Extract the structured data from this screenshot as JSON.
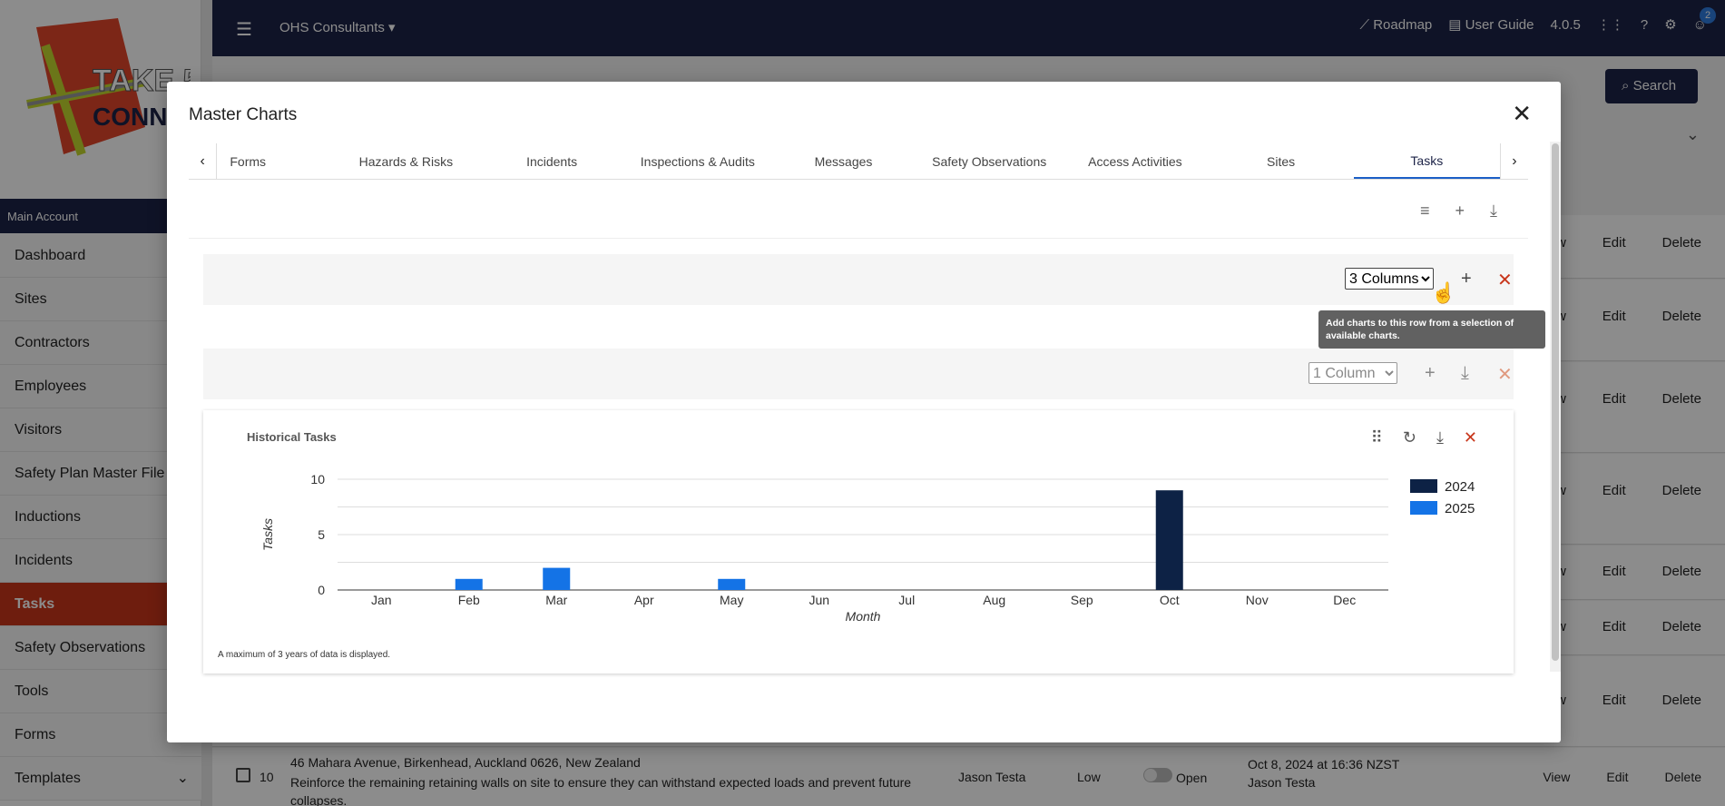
{
  "app": {
    "org_name": "OHS Consultants",
    "roadmap": "Roadmap",
    "user_guide": "User Guide",
    "version": "4.0.5",
    "notif_count": "2",
    "page_title": "Tasks",
    "search_label": "Search"
  },
  "sidebar": {
    "account": "Main Account",
    "items": [
      {
        "label": "Dashboard"
      },
      {
        "label": "Sites"
      },
      {
        "label": "Contractors"
      },
      {
        "label": "Employees"
      },
      {
        "label": "Visitors"
      },
      {
        "label": "Safety Plan Master File"
      },
      {
        "label": "Inductions"
      },
      {
        "label": "Incidents"
      },
      {
        "label": "Tasks"
      },
      {
        "label": "Safety Observations"
      },
      {
        "label": "Tools"
      },
      {
        "label": "Forms"
      },
      {
        "label": "Templates"
      }
    ]
  },
  "row_actions": {
    "view": "View",
    "edit": "Edit",
    "delete": "Delete"
  },
  "task_row": {
    "number": "10",
    "address": "46 Mahara Avenue, Birkenhead, Auckland 0626, New Zealand",
    "description": "Reinforce the remaining retaining walls on site to ensure they can withstand expected loads and prevent future collapses.",
    "assignee": "Jason Testa",
    "priority": "Low",
    "status": "Open",
    "date": "Oct 8, 2024 at 16:36 NZST",
    "creator": "Jason Testa"
  },
  "modal": {
    "title": "Master Charts",
    "tabs": [
      {
        "label": "Forms"
      },
      {
        "label": "Hazards & Risks"
      },
      {
        "label": "Incidents"
      },
      {
        "label": "Inspections & Audits"
      },
      {
        "label": "Messages"
      },
      {
        "label": "Safety Observations"
      },
      {
        "label": "Access Activities"
      },
      {
        "label": "Sites"
      },
      {
        "label": "Tasks"
      }
    ],
    "row1_columns": "3 Columns",
    "row2_columns": "1 Column",
    "tooltip": "Add charts to this row from a selection of available charts.",
    "chart_title": "Historical Tasks",
    "chart_note": "A maximum of 3 years of data is displayed."
  },
  "chart_data": {
    "type": "bar",
    "title": "Historical Tasks",
    "xlabel": "Month",
    "ylabel": "Tasks",
    "ylim": [
      0,
      10
    ],
    "yticks": [
      0,
      5,
      10
    ],
    "categories": [
      "Jan",
      "Feb",
      "Mar",
      "Apr",
      "May",
      "Jun",
      "Jul",
      "Aug",
      "Sep",
      "Oct",
      "Nov",
      "Dec"
    ],
    "series": [
      {
        "name": "2024",
        "color": "#0d2245",
        "values": [
          0,
          0,
          0,
          0,
          0,
          0,
          0,
          0,
          0,
          9,
          0,
          0
        ]
      },
      {
        "name": "2025",
        "color": "#1473e6",
        "values": [
          0,
          1,
          2,
          0,
          1,
          0,
          0,
          0,
          0,
          0,
          0,
          0
        ]
      }
    ],
    "grid": true,
    "legend": "right"
  }
}
